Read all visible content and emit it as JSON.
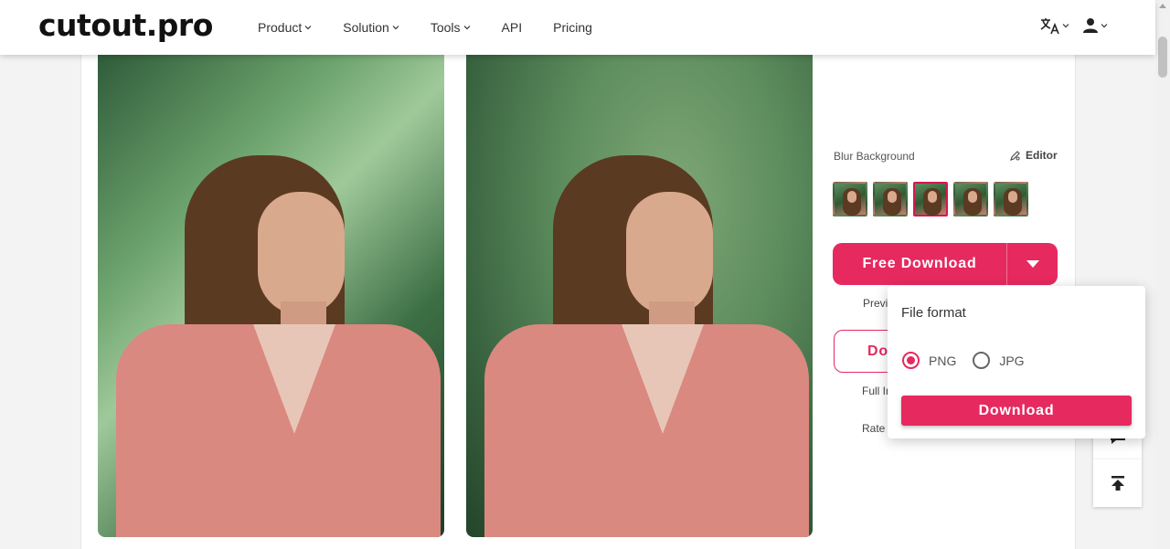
{
  "header": {
    "logo": "cutout.pro",
    "nav": [
      "Product",
      "Solution",
      "Tools",
      "API",
      "Pricing"
    ],
    "nav_has_dropdown": [
      true,
      true,
      true,
      false,
      false
    ],
    "translate_icon": "translate-icon",
    "user_icon": "user-icon"
  },
  "panel": {
    "blur_label": "Blur Background",
    "editor_label": "Editor",
    "thumbnail_count": 5,
    "selected_thumbnail": 3,
    "free_download": "Free Download",
    "preview_text": "Previ",
    "outline_button": "Do",
    "full_text": "Full In",
    "rate_text": "Rate"
  },
  "popup": {
    "title": "File format",
    "options": [
      "PNG",
      "JPG"
    ],
    "selected": "PNG",
    "button": "Download"
  },
  "side_tools": {
    "comment_icon": "comment-icon",
    "top_icon": "back-to-top-icon"
  },
  "colors": {
    "accent": "#e6295f",
    "selected_border": "#d6174f"
  }
}
